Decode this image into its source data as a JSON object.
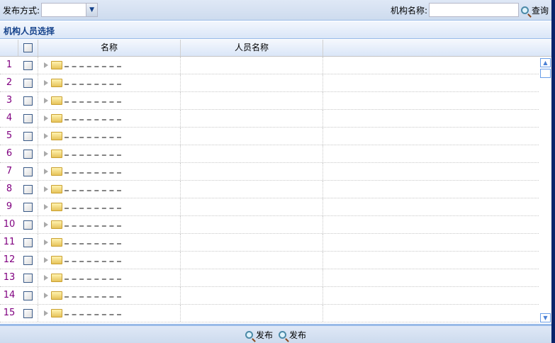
{
  "toolbar": {
    "publish_mode_label": "发布方式:",
    "publish_mode_value": "",
    "org_name_label": "机构名称:",
    "org_name_value": "",
    "query_label": "查询"
  },
  "panel": {
    "title": "机构人员选择"
  },
  "grid": {
    "columns": [
      "",
      "",
      "名称",
      "人员名称"
    ],
    "rows": [
      {
        "n": "1"
      },
      {
        "n": "2"
      },
      {
        "n": "3"
      },
      {
        "n": "4"
      },
      {
        "n": "5"
      },
      {
        "n": "6"
      },
      {
        "n": "7"
      },
      {
        "n": "8"
      },
      {
        "n": "9"
      },
      {
        "n": "10"
      },
      {
        "n": "11"
      },
      {
        "n": "12"
      },
      {
        "n": "13"
      },
      {
        "n": "14"
      },
      {
        "n": "15"
      }
    ]
  },
  "footer": {
    "buttons": [
      "发布",
      "发布"
    ]
  }
}
